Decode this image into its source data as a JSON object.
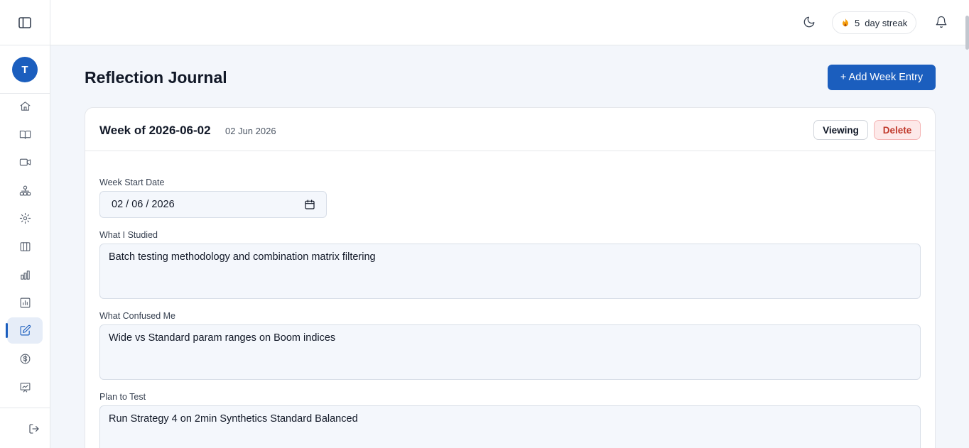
{
  "sidebar": {
    "avatar_initial": "T",
    "nav": [
      {
        "icon": "home-icon"
      },
      {
        "icon": "book-icon"
      },
      {
        "icon": "video-icon"
      },
      {
        "icon": "org-chart-icon"
      },
      {
        "icon": "gear-icon"
      },
      {
        "icon": "columns-icon"
      },
      {
        "icon": "bar-chart-icon"
      },
      {
        "icon": "report-icon"
      },
      {
        "icon": "edit-icon",
        "active": true
      },
      {
        "icon": "dollar-icon"
      },
      {
        "icon": "presentation-chart-icon"
      }
    ],
    "logout_icon": "logout-icon"
  },
  "topbar": {
    "streak_count": "5",
    "streak_label": "day streak",
    "icons": [
      "moon-icon",
      "flame-icon",
      "bell-icon"
    ]
  },
  "main": {
    "title": "Reflection Journal",
    "add_button": "+ Add Week Entry",
    "entry": {
      "title": "Week of 2026-06-02",
      "date": "02 Jun 2026",
      "viewing_button": "Viewing",
      "delete_button": "Delete",
      "fields": {
        "week_start_label": "Week Start Date",
        "week_start_value": "02 / 06 / 2026",
        "studied_label": "What I Studied",
        "studied_value": "Batch testing methodology and combination matrix filtering",
        "confused_label": "What Confused Me",
        "confused_value": "Wide vs Standard param ranges on Boom indices",
        "plan_label": "Plan to Test",
        "plan_value": "Run Strategy 4 on 2min Synthetics Standard Balanced"
      }
    }
  },
  "colors": {
    "accent": "#1b5ebe",
    "danger": "#c0392b",
    "page_bg": "#f3f6fb"
  }
}
